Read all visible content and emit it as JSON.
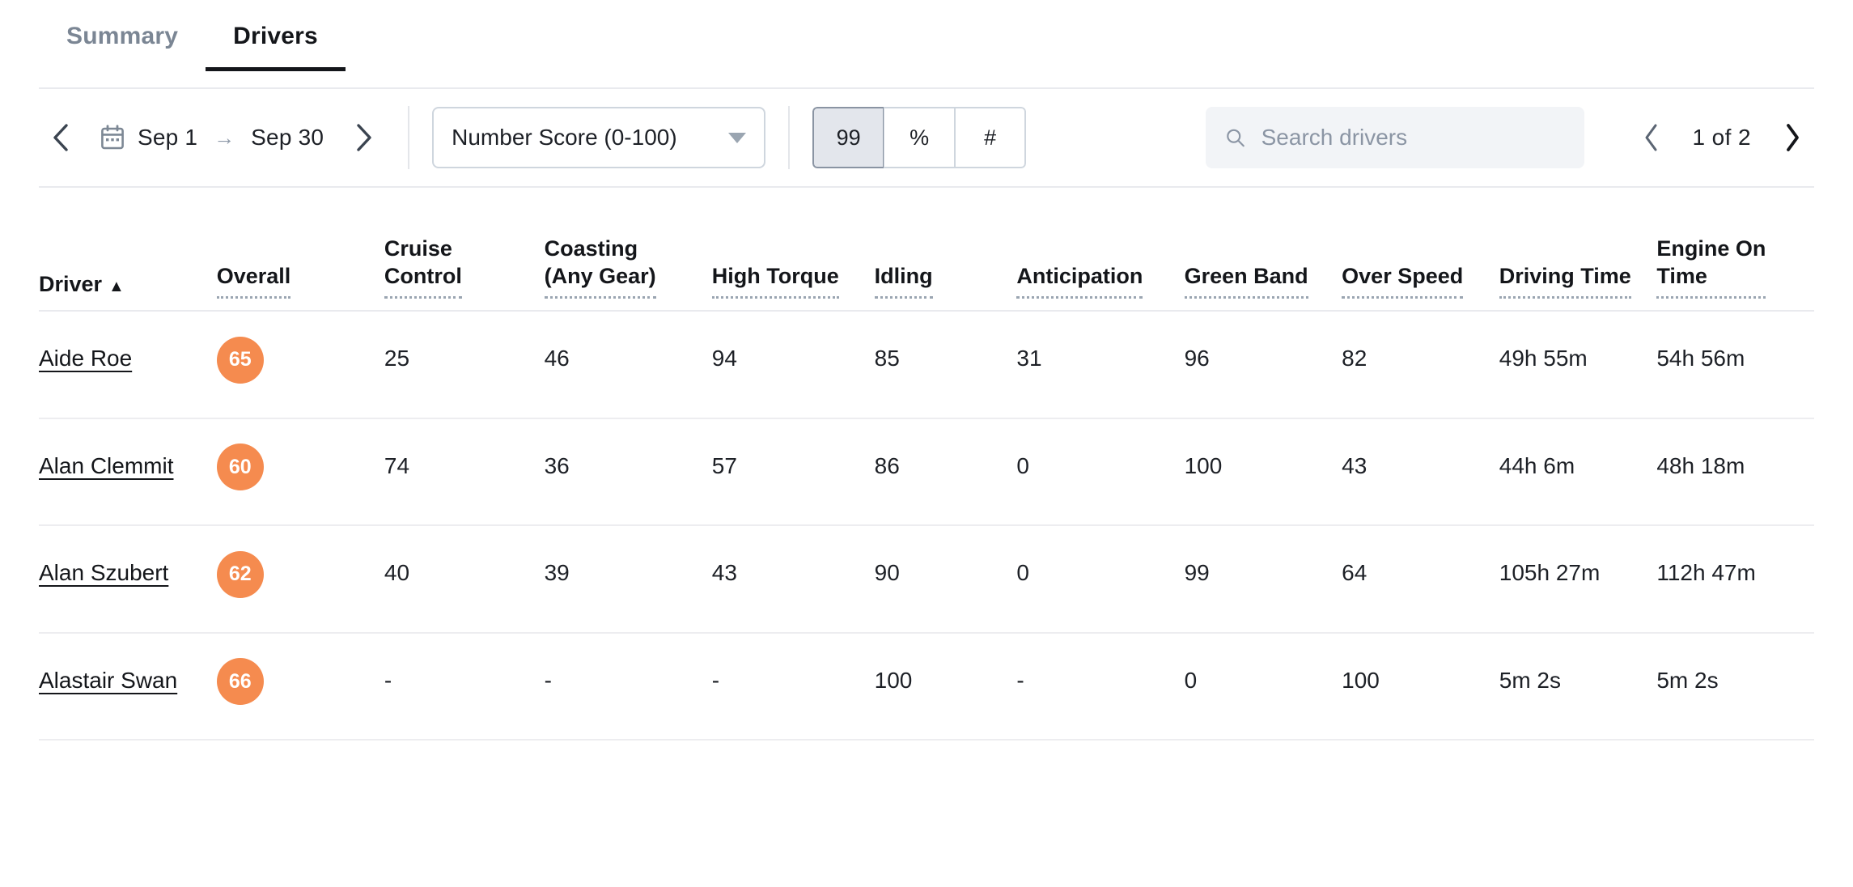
{
  "tabs": [
    {
      "label": "Summary",
      "active": false
    },
    {
      "label": "Drivers",
      "active": true
    }
  ],
  "toolbar": {
    "prev_period_icon": "chevron-left-icon",
    "next_period_icon": "chevron-right-icon",
    "calendar_icon": "calendar-icon",
    "date_start": "Sep 1",
    "date_arrow": "→",
    "date_end": "Sep 30",
    "metric_select": {
      "value": "Number Score (0-100)",
      "caret_icon": "chevron-down-icon"
    },
    "segmented": [
      {
        "label": "99",
        "active": true
      },
      {
        "label": "%",
        "active": false
      },
      {
        "label": "#",
        "active": false
      }
    ],
    "search": {
      "icon": "search-icon",
      "value": "",
      "placeholder": "Search drivers"
    },
    "pagination": {
      "prev_icon": "chevron-left-icon",
      "next_icon": "chevron-right-icon",
      "text": "1 of 2",
      "current_page": 1,
      "total_pages": 2
    }
  },
  "table": {
    "columns": [
      {
        "key": "driver",
        "label": "Driver",
        "label2": "",
        "dotted": false,
        "sorted": true,
        "sort_dir": "▲"
      },
      {
        "key": "overall",
        "label": "Overall",
        "label2": "",
        "dotted": true
      },
      {
        "key": "cruise",
        "label": "Cruise",
        "label2": "Control",
        "dotted": true
      },
      {
        "key": "coasting",
        "label": "Coasting",
        "label2": "(Any Gear)",
        "dotted": true
      },
      {
        "key": "high_torque",
        "label": "High Torque",
        "label2": "",
        "dotted": true
      },
      {
        "key": "idling",
        "label": "Idling",
        "label2": "",
        "dotted": true
      },
      {
        "key": "anticipation",
        "label": "Anticipation",
        "label2": "",
        "dotted": true
      },
      {
        "key": "green_band",
        "label": "Green Band",
        "label2": "",
        "dotted": true
      },
      {
        "key": "over_speed",
        "label": "Over Speed",
        "label2": "",
        "dotted": true
      },
      {
        "key": "driving_time",
        "label": "Driving Time",
        "label2": "",
        "dotted": true
      },
      {
        "key": "engine_on",
        "label": "Engine On",
        "label2": "Time",
        "dotted": true
      }
    ],
    "badge_color": "#f58b4f",
    "rows": [
      {
        "driver": "Aide Roe",
        "overall": "65",
        "cruise": "25",
        "coasting": "46",
        "high_torque": "94",
        "idling": "85",
        "anticipation": "31",
        "green_band": "96",
        "over_speed": "82",
        "driving_time": "49h 55m",
        "engine_on": "54h 56m"
      },
      {
        "driver": "Alan Clemmit",
        "overall": "60",
        "cruise": "74",
        "coasting": "36",
        "high_torque": "57",
        "idling": "86",
        "anticipation": "0",
        "green_band": "100",
        "over_speed": "43",
        "driving_time": "44h 6m",
        "engine_on": "48h 18m"
      },
      {
        "driver": "Alan Szubert",
        "overall": "62",
        "cruise": "40",
        "coasting": "39",
        "high_torque": "43",
        "idling": "90",
        "anticipation": "0",
        "green_band": "99",
        "over_speed": "64",
        "driving_time": "105h 27m",
        "engine_on": "112h 47m"
      },
      {
        "driver": "Alastair Swan",
        "overall": "66",
        "cruise": "-",
        "coasting": "-",
        "high_torque": "-",
        "idling": "100",
        "anticipation": "-",
        "green_band": "0",
        "over_speed": "100",
        "driving_time": "5m 2s",
        "engine_on": "5m 2s"
      }
    ]
  }
}
